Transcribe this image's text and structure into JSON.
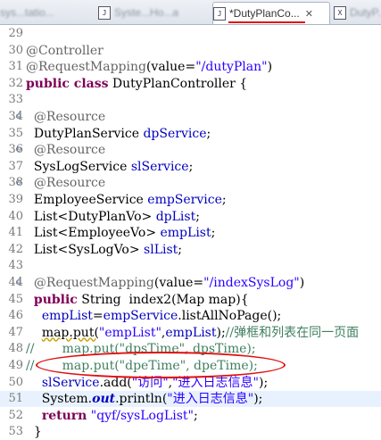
{
  "tabs": [
    {
      "label": "sys...tatio...",
      "icon": "J"
    },
    {
      "label": "Syste...Ho...a",
      "icon": "J"
    },
    {
      "label": "*DutyPlanCo...",
      "icon": "J",
      "active": true
    },
    {
      "label": "DutyP...",
      "icon": "X"
    }
  ],
  "lines": [
    {
      "num": "29",
      "segs": [
        {
          "t": ""
        }
      ]
    },
    {
      "num": "30",
      "segs": [
        {
          "t": "@Controller",
          "c": "ann"
        }
      ]
    },
    {
      "num": "31",
      "segs": [
        {
          "t": "@RequestMapping",
          "c": "ann"
        },
        {
          "t": "(value="
        },
        {
          "t": "\"/dutyPlan\"",
          "c": "str"
        },
        {
          "t": ")"
        }
      ]
    },
    {
      "num": "32",
      "segs": [
        {
          "t": "public class",
          "c": "kw"
        },
        {
          "t": " DutyPlanController {"
        }
      ]
    },
    {
      "num": "33",
      "segs": [
        {
          "t": ""
        }
      ]
    },
    {
      "num": "34",
      "fold": true,
      "segs": [
        {
          "t": "  @Resource",
          "c": "ann"
        }
      ]
    },
    {
      "num": "35",
      "segs": [
        {
          "t": "  DutyPlanService "
        },
        {
          "t": "dpService",
          "c": "fld"
        },
        {
          "t": ";"
        }
      ]
    },
    {
      "num": "36",
      "fold": true,
      "segs": [
        {
          "t": "  @Resource",
          "c": "ann"
        }
      ]
    },
    {
      "num": "37",
      "segs": [
        {
          "t": "  SysLogService "
        },
        {
          "t": "slService",
          "c": "fld"
        },
        {
          "t": ";"
        }
      ]
    },
    {
      "num": "38",
      "fold": true,
      "segs": [
        {
          "t": "  @Resource",
          "c": "ann"
        }
      ]
    },
    {
      "num": "39",
      "segs": [
        {
          "t": "  EmployeeService "
        },
        {
          "t": "empService",
          "c": "fld"
        },
        {
          "t": ";"
        }
      ]
    },
    {
      "num": "40",
      "segs": [
        {
          "t": "  List<DutyPlanVo> "
        },
        {
          "t": "dpList",
          "c": "fld"
        },
        {
          "t": ";"
        }
      ]
    },
    {
      "num": "41",
      "segs": [
        {
          "t": "  List<EmployeeVo> "
        },
        {
          "t": "empList",
          "c": "fld"
        },
        {
          "t": ";"
        }
      ]
    },
    {
      "num": "42",
      "segs": [
        {
          "t": "  List<SysLogVo> "
        },
        {
          "t": "slList",
          "c": "fld"
        },
        {
          "t": ";"
        }
      ]
    },
    {
      "num": "43",
      "segs": [
        {
          "t": ""
        }
      ]
    },
    {
      "num": "44",
      "fold": true,
      "segs": [
        {
          "t": "  @RequestMapping",
          "c": "ann"
        },
        {
          "t": "(value="
        },
        {
          "t": "\"/indexSysLog\"",
          "c": "str"
        },
        {
          "t": ")"
        }
      ]
    },
    {
      "num": "45",
      "segs": [
        {
          "t": "  "
        },
        {
          "t": "public",
          "c": "kw"
        },
        {
          "t": " String  index2(Map map){"
        }
      ]
    },
    {
      "num": "46",
      "segs": [
        {
          "t": "    "
        },
        {
          "t": "empList",
          "c": "fld"
        },
        {
          "t": "="
        },
        {
          "t": "empService",
          "c": "fld"
        },
        {
          "t": ".listAllNoPage();"
        }
      ]
    },
    {
      "num": "47",
      "segs": [
        {
          "t": "    "
        },
        {
          "t": "map.put(",
          "c": "wavy"
        },
        {
          "t": "\"empList\"",
          "c": "str"
        },
        {
          "t": ","
        },
        {
          "t": "empList",
          "c": "fld"
        },
        {
          "t": ");"
        },
        {
          "t": "//弹框和列表在同一页面",
          "c": "cmt"
        }
      ]
    },
    {
      "num": "48",
      "segs": [
        {
          "t": "//       map.put(\"dpsTime\", dpsTime);",
          "c": "cmt"
        }
      ]
    },
    {
      "num": "49",
      "segs": [
        {
          "t": "//       map.put(\"dpeTime\", dpeTime);",
          "c": "cmt"
        }
      ]
    },
    {
      "num": "50",
      "segs": [
        {
          "t": "    "
        },
        {
          "t": "slService",
          "c": "fld"
        },
        {
          "t": ".add("
        },
        {
          "t": "\"访问\"",
          "c": "str"
        },
        {
          "t": ","
        },
        {
          "t": "\"进入日志信息\"",
          "c": "str"
        },
        {
          "t": ");"
        }
      ]
    },
    {
      "num": "51",
      "hl": true,
      "segs": [
        {
          "t": "    System."
        },
        {
          "t": "out",
          "c": "sfld"
        },
        {
          "t": ".println("
        },
        {
          "t": "\"进入日志信息\"",
          "c": "str"
        },
        {
          "t": ");"
        }
      ]
    },
    {
      "num": "52",
      "segs": [
        {
          "t": "    "
        },
        {
          "t": "return",
          "c": "kw"
        },
        {
          "t": " "
        },
        {
          "t": "\"qyf/sysLogList\"",
          "c": "str"
        },
        {
          "t": ";"
        }
      ]
    },
    {
      "num": "53",
      "segs": [
        {
          "t": "  }"
        }
      ]
    }
  ]
}
